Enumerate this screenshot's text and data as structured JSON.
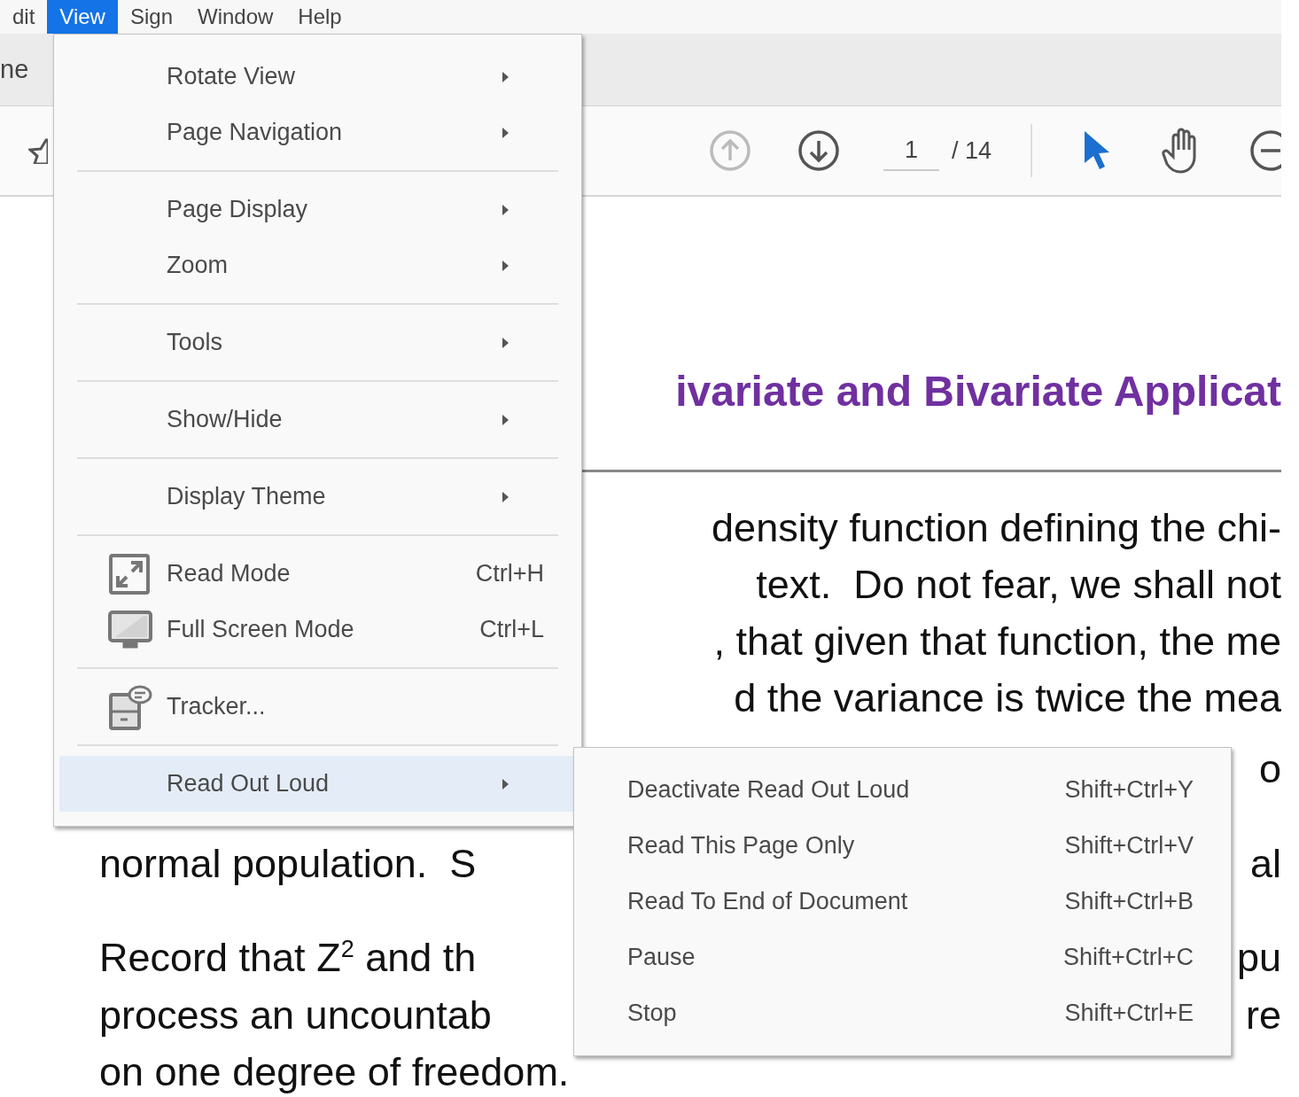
{
  "menubar": {
    "items": [
      {
        "label": "dit",
        "selected": false
      },
      {
        "label": "View",
        "selected": true
      },
      {
        "label": "Sign",
        "selected": false
      },
      {
        "label": "Window",
        "selected": false
      },
      {
        "label": "Help",
        "selected": false
      }
    ]
  },
  "tab_bar": {
    "tab_label": "ne"
  },
  "toolbar": {
    "previous_page": {
      "disabled": true
    },
    "next_page": {
      "disabled": false
    },
    "page_number": "1",
    "page_count": "/ 14",
    "select_tool": {
      "selected": true
    },
    "hand_tool": {
      "selected": false
    }
  },
  "document": {
    "title": "ivariate and Bivariate Applicat",
    "lines": [
      {
        "right": "density function defining the chi-"
      },
      {
        "right": "text.  Do not fear, we shall not"
      },
      {
        "right": ", that given that function, the me"
      },
      {
        "right": "d the variance is twice the mea"
      },
      {
        "right": "o"
      },
      {
        "left": "normal population.  S",
        "right": "al"
      },
      {
        "left": "Record that Z$^{2}$ and th",
        "right": "pu"
      },
      {
        "left": "process an uncountab",
        "right": "re"
      },
      {
        "left": "on one degree of freedom."
      }
    ]
  },
  "view_menu": {
    "groups": [
      [
        {
          "label": "Rotate View",
          "kind": "submenu",
          "selected": false
        },
        {
          "label": "Page Navigation",
          "kind": "submenu",
          "selected": false
        }
      ],
      [
        {
          "label": "Page Display",
          "kind": "submenu",
          "selected": false
        },
        {
          "label": "Zoom",
          "kind": "submenu",
          "selected": false
        }
      ],
      [
        {
          "label": "Tools",
          "kind": "submenu",
          "selected": false
        }
      ],
      [
        {
          "label": "Show/Hide",
          "kind": "submenu",
          "selected": false
        }
      ],
      [
        {
          "label": "Display Theme",
          "kind": "submenu",
          "selected": false
        }
      ],
      [
        {
          "label": "Read Mode",
          "kind": "command",
          "icon": true,
          "shortcut": "Ctrl+H",
          "selected": false
        },
        {
          "label": "Full Screen Mode",
          "kind": "command",
          "icon": true,
          "shortcut": "Ctrl+L",
          "selected": false
        }
      ],
      [
        {
          "label": "Tracker...",
          "kind": "command",
          "icon": true,
          "selected": false
        }
      ],
      [
        {
          "label": "Read Out Loud",
          "kind": "submenu",
          "selected": true
        }
      ]
    ]
  },
  "read_out_loud_menu": {
    "groups": [
      [
        {
          "label": "Deactivate Read Out Loud",
          "kind": "command",
          "shortcut": "Shift+Ctrl+Y",
          "selected": false
        },
        {
          "label": "Read This Page Only",
          "kind": "command",
          "shortcut": "Shift+Ctrl+V",
          "selected": false
        },
        {
          "label": "Read To End of Document",
          "kind": "command",
          "shortcut": "Shift+Ctrl+B",
          "selected": false
        },
        {
          "label": "Pause",
          "kind": "command",
          "shortcut": "Shift+Ctrl+C",
          "selected": false
        },
        {
          "label": "Stop",
          "kind": "command",
          "shortcut": "Shift+Ctrl+E",
          "selected": false
        }
      ]
    ]
  }
}
